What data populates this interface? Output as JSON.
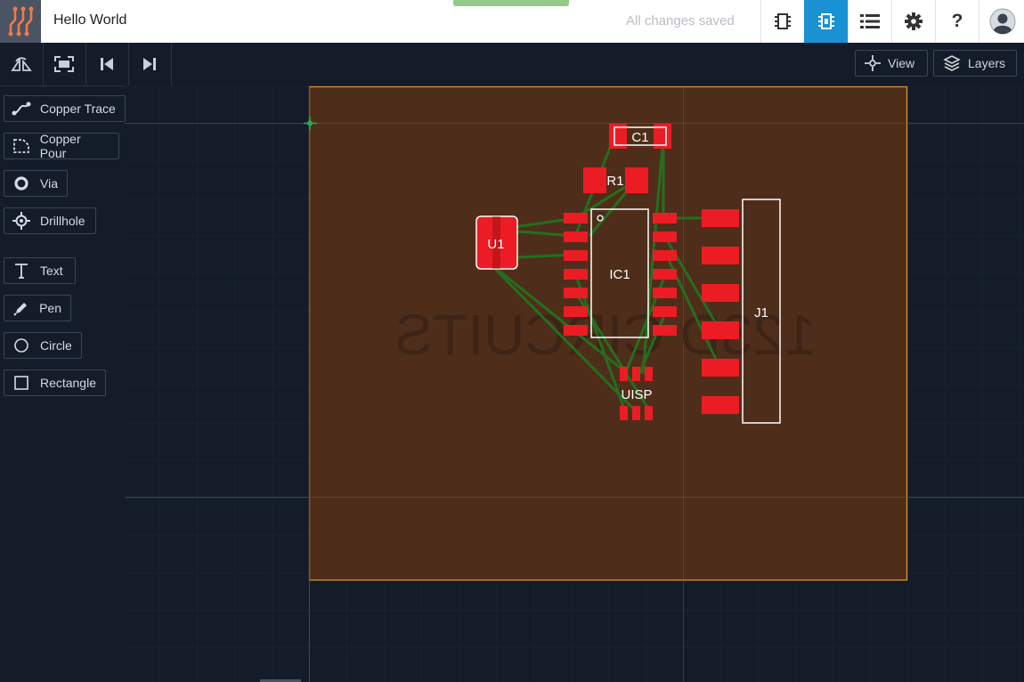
{
  "header": {
    "logo_icon": "circuits-logo-icon",
    "project_title": "Hello World",
    "save_status": "All changes saved",
    "buttons": [
      {
        "name": "schematic-view-button",
        "icon": "chip-outline-icon",
        "active": false
      },
      {
        "name": "pcb-view-button",
        "icon": "pcb-chip-icon",
        "active": true
      },
      {
        "name": "bom-list-button",
        "icon": "list-icon",
        "active": false
      },
      {
        "name": "settings-button",
        "icon": "gear-icon",
        "active": false
      },
      {
        "name": "help-button",
        "icon": "question-icon",
        "active": false
      },
      {
        "name": "account-button",
        "icon": "avatar-icon",
        "active": false
      }
    ],
    "help_label": "?"
  },
  "toolbar": {
    "buttons": [
      {
        "name": "rotate-view-button",
        "icon": "rotate-icon"
      },
      {
        "name": "fit-to-screen-button",
        "icon": "fit-screen-icon"
      },
      {
        "name": "step-back-button",
        "icon": "skip-back-icon"
      },
      {
        "name": "step-forward-button",
        "icon": "skip-forward-icon"
      }
    ],
    "view_label": "View",
    "layers_label": "Layers"
  },
  "tools": [
    {
      "label": "Copper Trace",
      "icon": "copper-trace-icon"
    },
    {
      "label": "Copper Pour",
      "icon": "copper-pour-icon"
    },
    {
      "label": "Via",
      "icon": "via-icon"
    },
    {
      "label": "Drillhole",
      "icon": "drillhole-icon"
    },
    {
      "label": "Text",
      "icon": "text-icon"
    },
    {
      "label": "Pen",
      "icon": "pen-icon"
    },
    {
      "label": "Circle",
      "icon": "circle-icon"
    },
    {
      "label": "Rectangle",
      "icon": "rectangle-icon"
    }
  ],
  "board": {
    "watermark": "123D CIRCUITS",
    "components": {
      "c1": "C1",
      "r1": "R1",
      "u1": "U1",
      "ic1": "IC1",
      "uisp": "UISP",
      "j1": "J1"
    },
    "colors": {
      "board_fill": "#4e2e1a",
      "board_outline": "#e39a2a",
      "pad": "#ec1c24",
      "trace": "#1f7a1f",
      "silkscreen": "#ffffff",
      "grid": "#1e2936"
    }
  }
}
